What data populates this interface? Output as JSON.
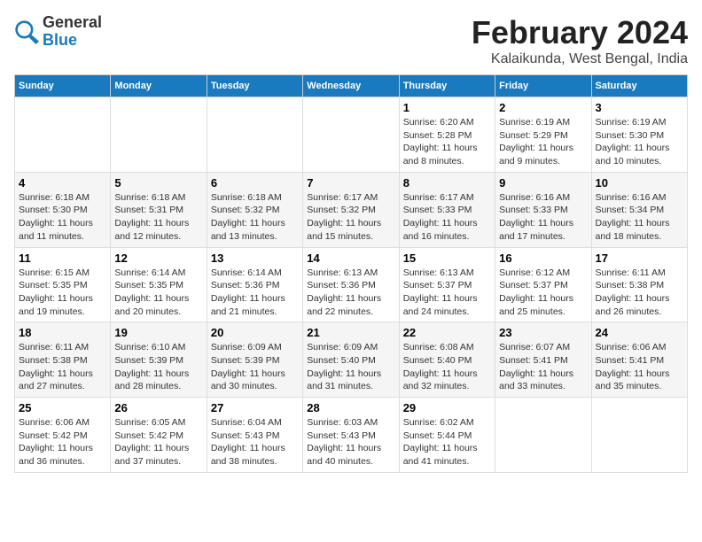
{
  "logo": {
    "general": "General",
    "blue": "Blue"
  },
  "title": "February 2024",
  "subtitle": "Kalaikunda, West Bengal, India",
  "days_of_week": [
    "Sunday",
    "Monday",
    "Tuesday",
    "Wednesday",
    "Thursday",
    "Friday",
    "Saturday"
  ],
  "weeks": [
    [
      {
        "day": "",
        "info": ""
      },
      {
        "day": "",
        "info": ""
      },
      {
        "day": "",
        "info": ""
      },
      {
        "day": "",
        "info": ""
      },
      {
        "day": "1",
        "info": "Sunrise: 6:20 AM\nSunset: 5:28 PM\nDaylight: 11 hours\nand 8 minutes."
      },
      {
        "day": "2",
        "info": "Sunrise: 6:19 AM\nSunset: 5:29 PM\nDaylight: 11 hours\nand 9 minutes."
      },
      {
        "day": "3",
        "info": "Sunrise: 6:19 AM\nSunset: 5:30 PM\nDaylight: 11 hours\nand 10 minutes."
      }
    ],
    [
      {
        "day": "4",
        "info": "Sunrise: 6:18 AM\nSunset: 5:30 PM\nDaylight: 11 hours\nand 11 minutes."
      },
      {
        "day": "5",
        "info": "Sunrise: 6:18 AM\nSunset: 5:31 PM\nDaylight: 11 hours\nand 12 minutes."
      },
      {
        "day": "6",
        "info": "Sunrise: 6:18 AM\nSunset: 5:32 PM\nDaylight: 11 hours\nand 13 minutes."
      },
      {
        "day": "7",
        "info": "Sunrise: 6:17 AM\nSunset: 5:32 PM\nDaylight: 11 hours\nand 15 minutes."
      },
      {
        "day": "8",
        "info": "Sunrise: 6:17 AM\nSunset: 5:33 PM\nDaylight: 11 hours\nand 16 minutes."
      },
      {
        "day": "9",
        "info": "Sunrise: 6:16 AM\nSunset: 5:33 PM\nDaylight: 11 hours\nand 17 minutes."
      },
      {
        "day": "10",
        "info": "Sunrise: 6:16 AM\nSunset: 5:34 PM\nDaylight: 11 hours\nand 18 minutes."
      }
    ],
    [
      {
        "day": "11",
        "info": "Sunrise: 6:15 AM\nSunset: 5:35 PM\nDaylight: 11 hours\nand 19 minutes."
      },
      {
        "day": "12",
        "info": "Sunrise: 6:14 AM\nSunset: 5:35 PM\nDaylight: 11 hours\nand 20 minutes."
      },
      {
        "day": "13",
        "info": "Sunrise: 6:14 AM\nSunset: 5:36 PM\nDaylight: 11 hours\nand 21 minutes."
      },
      {
        "day": "14",
        "info": "Sunrise: 6:13 AM\nSunset: 5:36 PM\nDaylight: 11 hours\nand 22 minutes."
      },
      {
        "day": "15",
        "info": "Sunrise: 6:13 AM\nSunset: 5:37 PM\nDaylight: 11 hours\nand 24 minutes."
      },
      {
        "day": "16",
        "info": "Sunrise: 6:12 AM\nSunset: 5:37 PM\nDaylight: 11 hours\nand 25 minutes."
      },
      {
        "day": "17",
        "info": "Sunrise: 6:11 AM\nSunset: 5:38 PM\nDaylight: 11 hours\nand 26 minutes."
      }
    ],
    [
      {
        "day": "18",
        "info": "Sunrise: 6:11 AM\nSunset: 5:38 PM\nDaylight: 11 hours\nand 27 minutes."
      },
      {
        "day": "19",
        "info": "Sunrise: 6:10 AM\nSunset: 5:39 PM\nDaylight: 11 hours\nand 28 minutes."
      },
      {
        "day": "20",
        "info": "Sunrise: 6:09 AM\nSunset: 5:39 PM\nDaylight: 11 hours\nand 30 minutes."
      },
      {
        "day": "21",
        "info": "Sunrise: 6:09 AM\nSunset: 5:40 PM\nDaylight: 11 hours\nand 31 minutes."
      },
      {
        "day": "22",
        "info": "Sunrise: 6:08 AM\nSunset: 5:40 PM\nDaylight: 11 hours\nand 32 minutes."
      },
      {
        "day": "23",
        "info": "Sunrise: 6:07 AM\nSunset: 5:41 PM\nDaylight: 11 hours\nand 33 minutes."
      },
      {
        "day": "24",
        "info": "Sunrise: 6:06 AM\nSunset: 5:41 PM\nDaylight: 11 hours\nand 35 minutes."
      }
    ],
    [
      {
        "day": "25",
        "info": "Sunrise: 6:06 AM\nSunset: 5:42 PM\nDaylight: 11 hours\nand 36 minutes."
      },
      {
        "day": "26",
        "info": "Sunrise: 6:05 AM\nSunset: 5:42 PM\nDaylight: 11 hours\nand 37 minutes."
      },
      {
        "day": "27",
        "info": "Sunrise: 6:04 AM\nSunset: 5:43 PM\nDaylight: 11 hours\nand 38 minutes."
      },
      {
        "day": "28",
        "info": "Sunrise: 6:03 AM\nSunset: 5:43 PM\nDaylight: 11 hours\nand 40 minutes."
      },
      {
        "day": "29",
        "info": "Sunrise: 6:02 AM\nSunset: 5:44 PM\nDaylight: 11 hours\nand 41 minutes."
      },
      {
        "day": "",
        "info": ""
      },
      {
        "day": "",
        "info": ""
      }
    ]
  ]
}
